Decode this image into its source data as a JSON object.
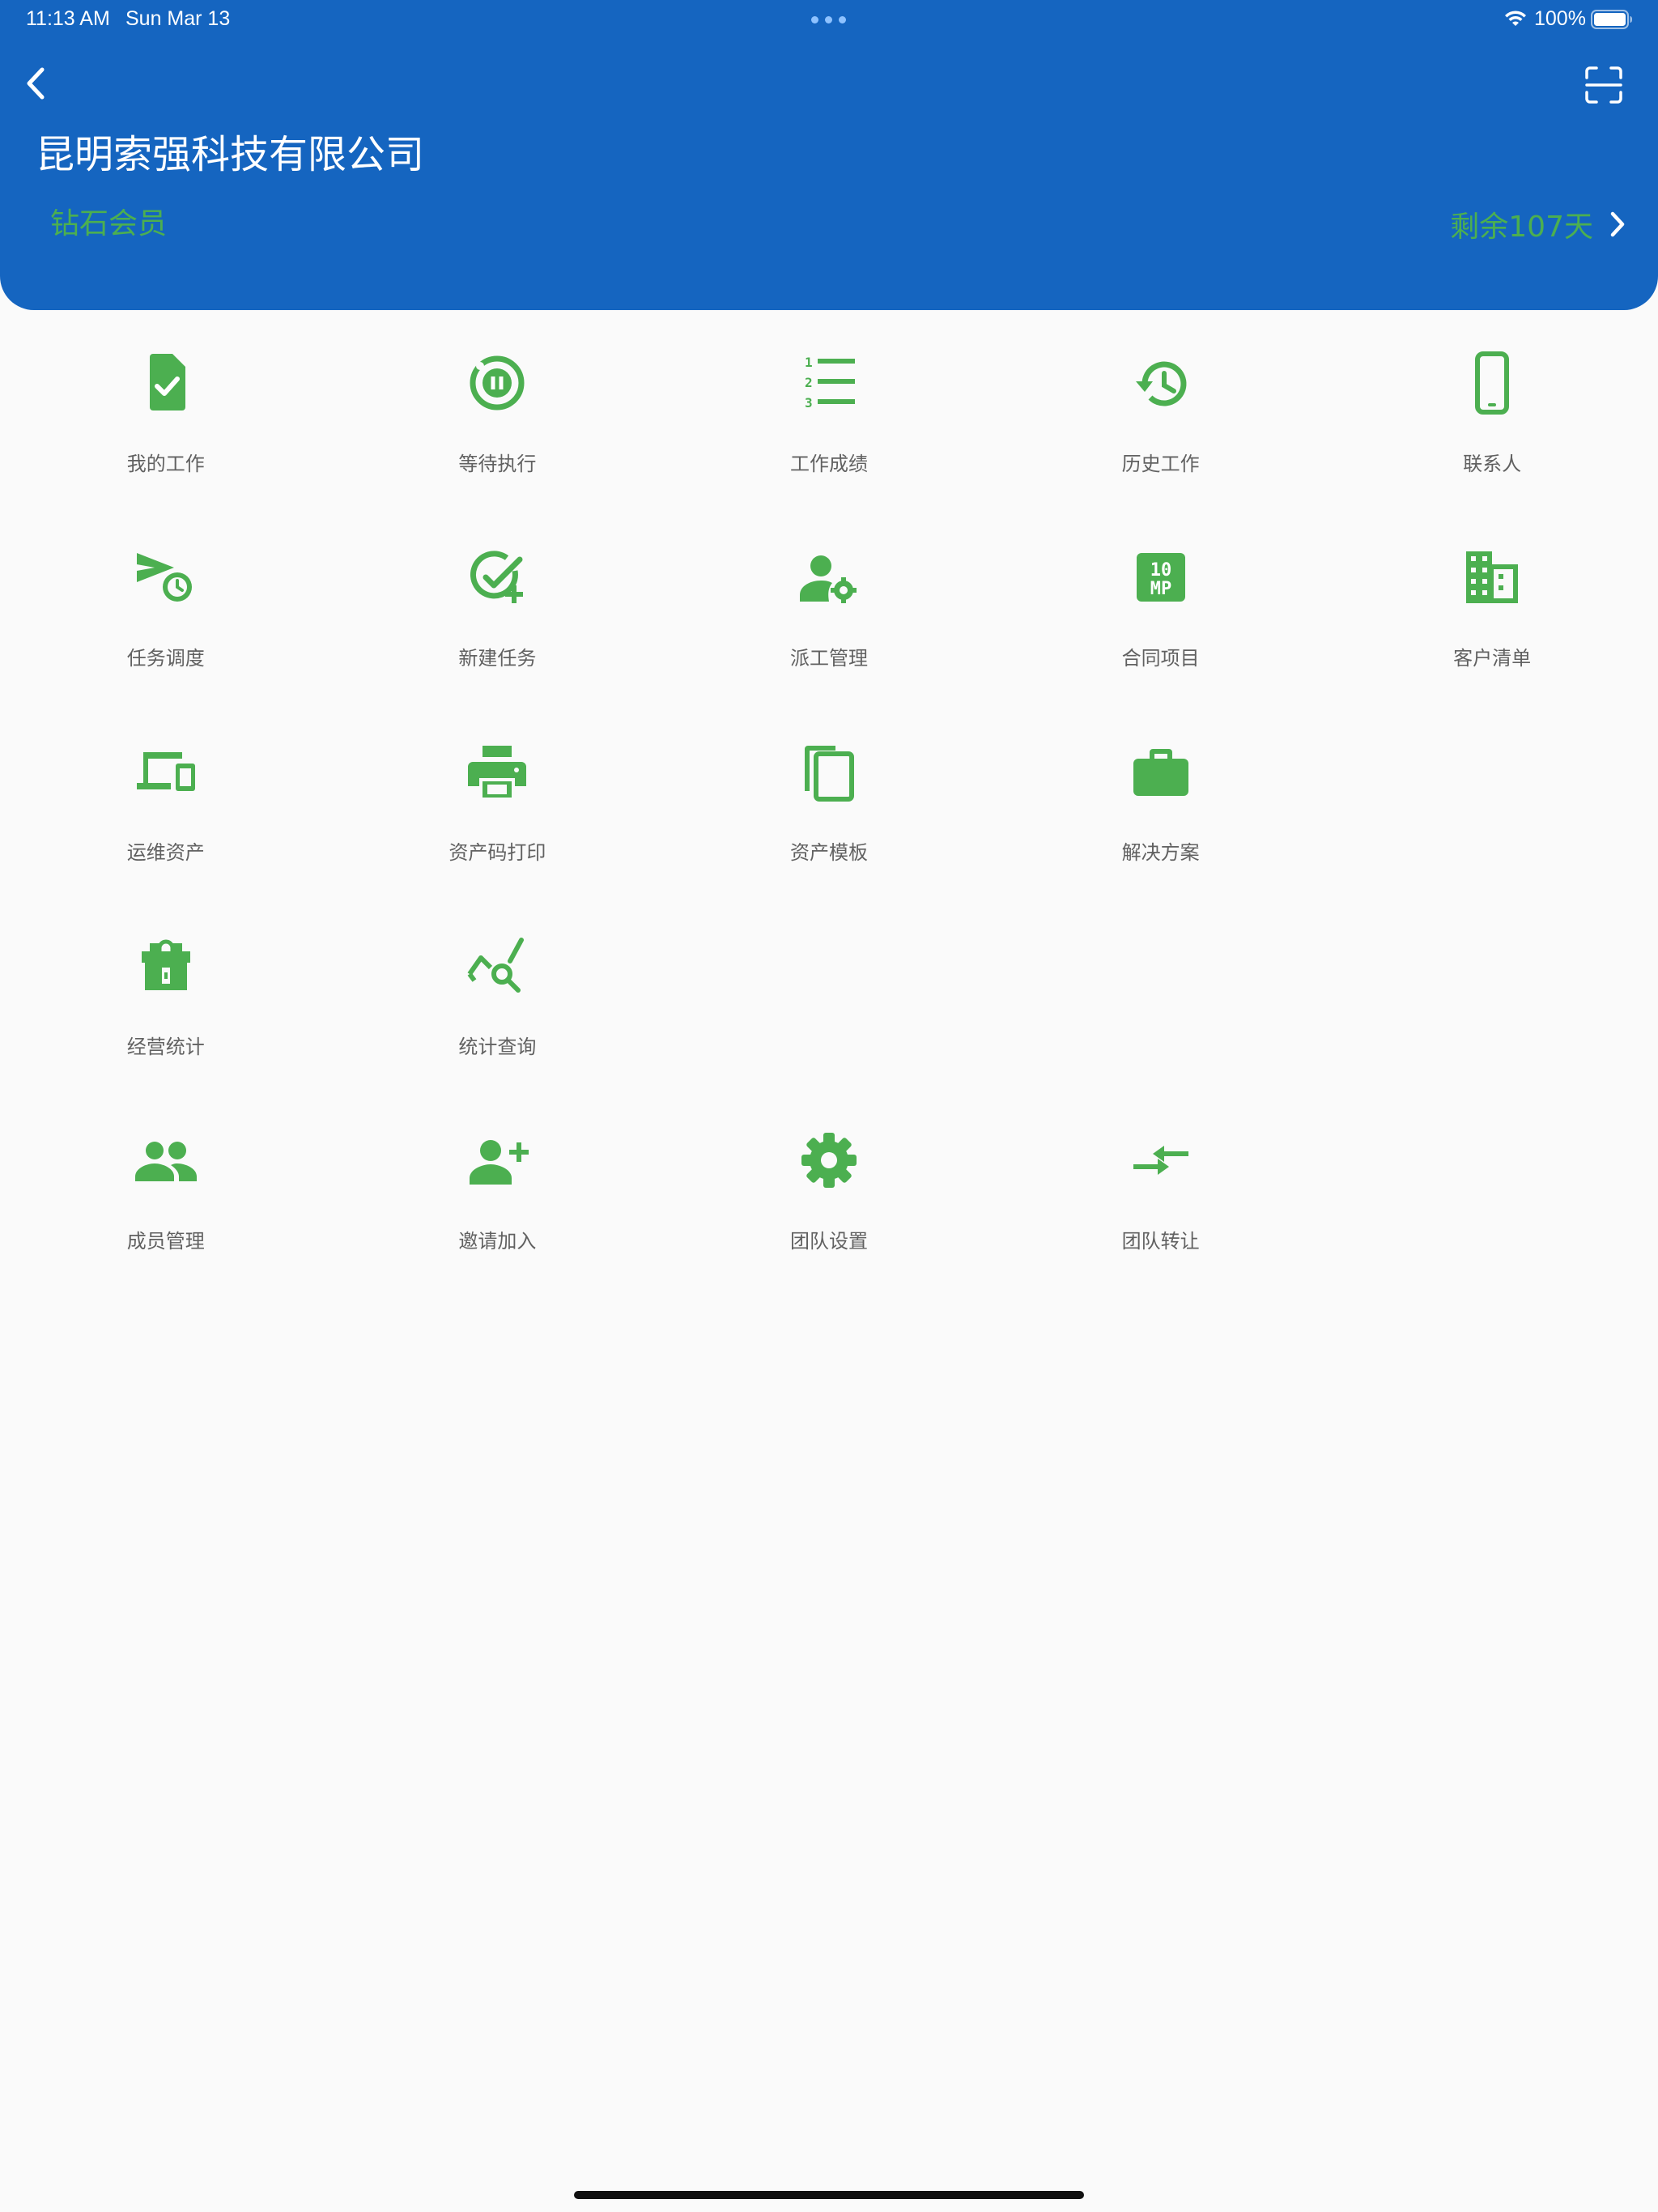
{
  "status_bar": {
    "time": "11:13 AM",
    "date": "Sun Mar 13",
    "battery": "100%"
  },
  "header": {
    "company_name": "昆明索强科技有限公司",
    "member_level": "钻石会员",
    "remaining": "剩余107天"
  },
  "colors": {
    "header_bg": "#1565c0",
    "accent_green": "#4caf50",
    "label_gray": "#616161",
    "page_bg": "#fafafa"
  },
  "menu": {
    "rows": [
      [
        {
          "label": "我的工作",
          "icon": "task-file-icon"
        },
        {
          "label": "等待执行",
          "icon": "pause-circle-icon"
        },
        {
          "label": "工作成绩",
          "icon": "numbered-list-icon"
        },
        {
          "label": "历史工作",
          "icon": "history-icon"
        },
        {
          "label": "联系人",
          "icon": "phone-icon"
        }
      ],
      [
        {
          "label": "任务调度",
          "icon": "schedule-send-icon"
        },
        {
          "label": "新建任务",
          "icon": "add-task-icon"
        },
        {
          "label": "派工管理",
          "icon": "person-gear-icon"
        },
        {
          "label": "合同项目",
          "icon": "10mp-icon"
        },
        {
          "label": "客户清单",
          "icon": "building-icon"
        }
      ],
      [
        {
          "label": "运维资产",
          "icon": "devices-icon"
        },
        {
          "label": "资产码打印",
          "icon": "printer-icon"
        },
        {
          "label": "资产模板",
          "icon": "copy-icon"
        },
        {
          "label": "解决方案",
          "icon": "briefcase-icon"
        }
      ],
      [
        {
          "label": "经营统计",
          "icon": "store-icon"
        },
        {
          "label": "统计查询",
          "icon": "query-stats-icon"
        }
      ],
      [
        {
          "label": "成员管理",
          "icon": "people-icon"
        },
        {
          "label": "邀请加入",
          "icon": "person-add-icon"
        },
        {
          "label": "团队设置",
          "icon": "settings-icon"
        },
        {
          "label": "团队转让",
          "icon": "compare-arrows-icon"
        }
      ]
    ]
  }
}
